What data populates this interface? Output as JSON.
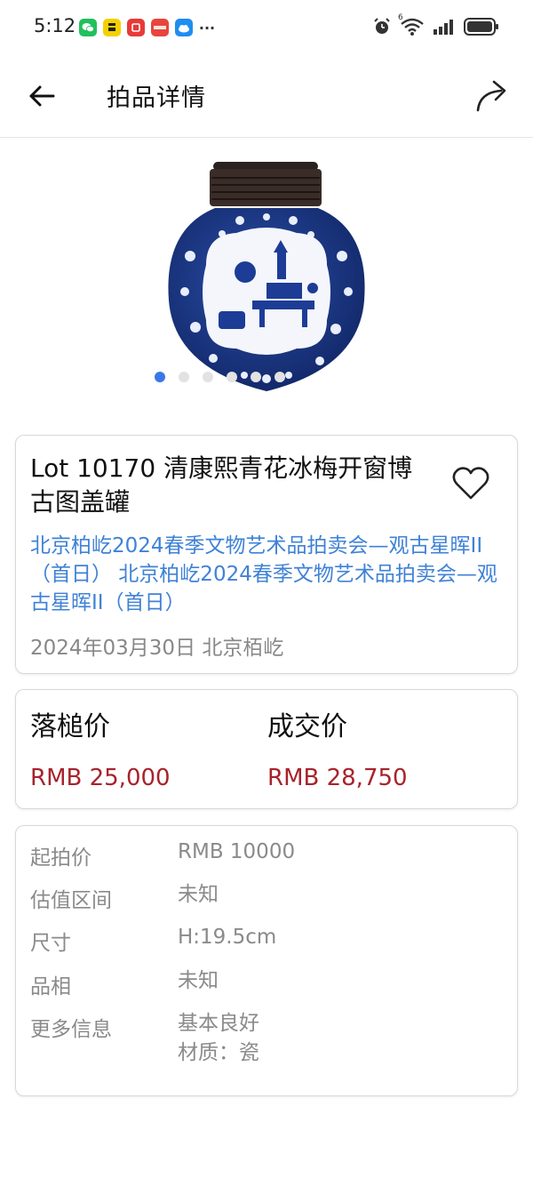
{
  "status": {
    "time": "5:12",
    "notif_icons": [
      "wechat-icon",
      "zhi-app-icon",
      "red-app-icon",
      "pinduoduo-icon",
      "weather-icon"
    ],
    "more": "···",
    "signal_superscript": "6"
  },
  "header": {
    "title": "拍品详情"
  },
  "carousel": {
    "total": 6,
    "active_index": 0
  },
  "lot": {
    "title": "Lot 10170 清康熙青花冰梅开窗博古图盖罐",
    "auction": "北京柏屹2024春季文物艺术品拍卖会—观古星晖II（首日） 北京柏屹2024春季文物艺术品拍卖会—观古星晖II（首日）",
    "date_house": "2024年03月30日 北京栢屹"
  },
  "prices": {
    "hammer_label": "落槌价",
    "hammer_value": "RMB 25,000",
    "sold_label": "成交价",
    "sold_value": "RMB 28,750"
  },
  "info": {
    "rows": [
      {
        "label": "起拍价",
        "value": "RMB 10000"
      },
      {
        "label": "估值区间",
        "value": "未知"
      },
      {
        "label": "尺寸",
        "value": "H:19.5cm"
      },
      {
        "label": "品相",
        "value": "未知"
      },
      {
        "label": "更多信息",
        "value": "基本良好",
        "value2": "材质：瓷"
      }
    ]
  },
  "colors": {
    "accent_blue": "#3f82d6",
    "price_red": "#a8232c",
    "dot_active": "#3a78e8"
  }
}
